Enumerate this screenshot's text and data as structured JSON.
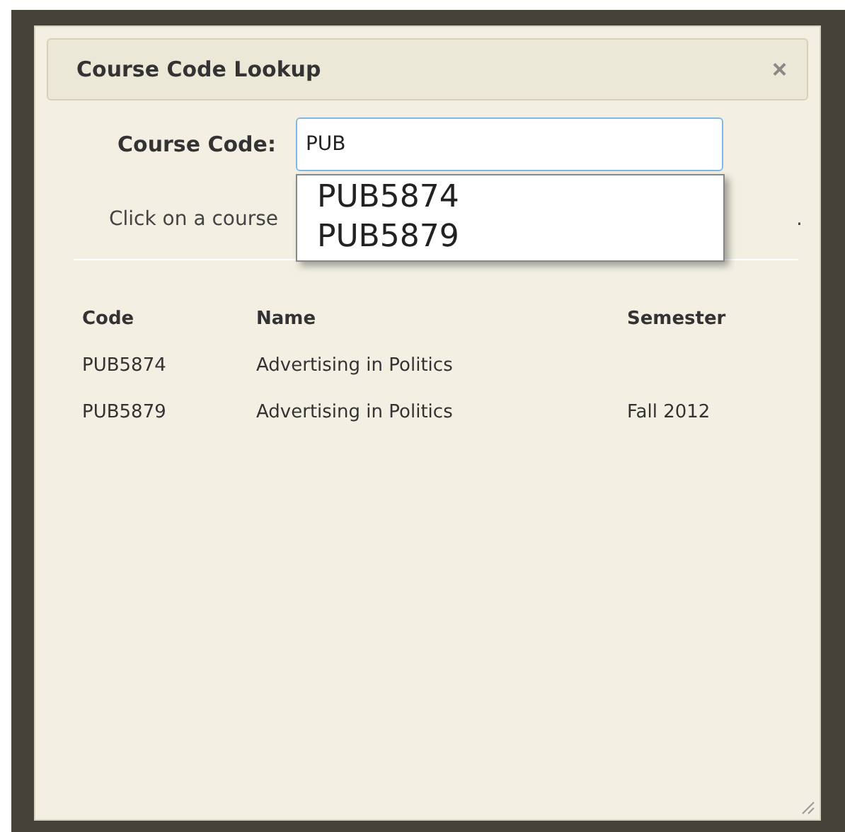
{
  "dialog": {
    "title": "Course Code Lookup",
    "close": "×"
  },
  "search": {
    "label": "Course Code:",
    "value": "PUB"
  },
  "suggestions": [
    {
      "text": "PUB5874"
    },
    {
      "text": "PUB5879"
    }
  ],
  "instruction": {
    "start": "Click on a course",
    "end": "."
  },
  "table": {
    "columns": [
      "Code",
      "Name",
      "Semester"
    ],
    "rows": [
      [
        "PUB5874",
        "Advertising in Politics"
      ],
      [
        "PUB5879",
        "Advertising in Politics",
        "Fall 2012"
      ]
    ]
  }
}
